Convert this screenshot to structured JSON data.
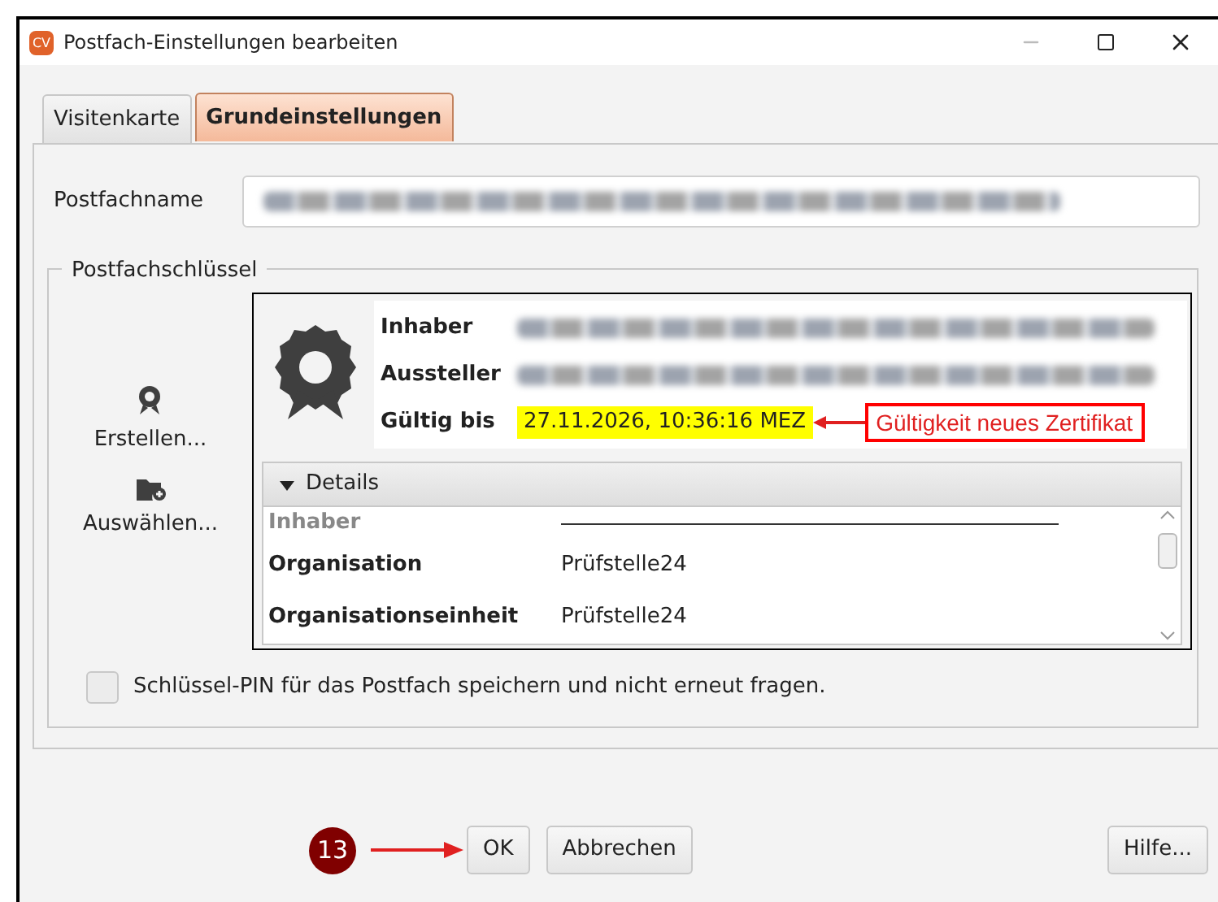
{
  "window": {
    "title": "Postfach-Einstellungen bearbeiten",
    "app_icon": "CV"
  },
  "tabs": [
    {
      "label": "Visitenkarte",
      "selected": false
    },
    {
      "label": "Grundeinstellungen",
      "selected": true
    }
  ],
  "postfachname": {
    "label": "Postfachname"
  },
  "key_group": {
    "title": "Postfachschlüssel",
    "actions": [
      {
        "label": "Erstellen...",
        "kind": "create"
      },
      {
        "label": "Auswählen...",
        "kind": "select"
      }
    ],
    "certificate": {
      "fields": [
        {
          "label": "Inhaber",
          "kind": "redacted"
        },
        {
          "label": "Aussteller",
          "kind": "redacted"
        },
        {
          "label": "Gültig bis",
          "kind": "highlighted",
          "value": "27.11.2026, 10:36:16 MEZ"
        }
      ],
      "annotation": "Gültigkeit neues Zertifikat",
      "details": {
        "title": "Details",
        "expanded": true,
        "rows": [
          {
            "kind": "heading",
            "label": "Inhaber"
          },
          {
            "kind": "field",
            "label": "Organisation",
            "value": "Prüfstelle24"
          },
          {
            "kind": "field",
            "label": "Organisationseinheit",
            "value": "Prüfstelle24"
          }
        ]
      }
    }
  },
  "pin_checkbox": {
    "label": "Schlüssel-PIN für das Postfach speichern und nicht erneut fragen.",
    "checked": false
  },
  "step_badge": "13",
  "buttons": [
    {
      "label": "OK"
    },
    {
      "label": "Abbrechen"
    },
    {
      "label": "Hilfe..."
    }
  ]
}
